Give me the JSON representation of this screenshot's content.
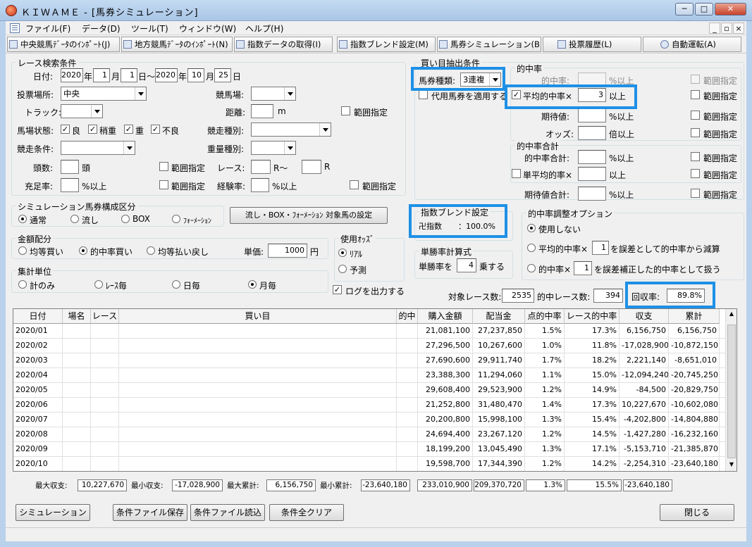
{
  "window": {
    "title": "ＫＩＷＡＭＥ - [馬券シミュレーション]",
    "min": "─",
    "max": "□",
    "close": "✕"
  },
  "menu": {
    "file": "ファイル(F)",
    "data": "データ(D)",
    "tool": "ツール(T)",
    "window": "ウィンドウ(W)",
    "help": "ヘルプ(H)",
    "mdi_min": "_",
    "mdi_restore": "▫",
    "mdi_close": "×"
  },
  "toolbar": {
    "b1": "中央競馬ﾃﾞｰﾀのｲﾝﾎﾟｰﾄ(J)",
    "b2": "地方競馬ﾃﾞｰﾀのｲﾝﾎﾟｰﾄ(N)",
    "b3": "指数データの取得(I)",
    "b4": "指数ブレンド設定(M)",
    "b5": "馬券シミュレーション(B)",
    "b6": "投票履歴(L)",
    "b7": "自動運転(A)"
  },
  "search": {
    "title": "レース検索条件",
    "date_lbl": "日付:",
    "y1": "2020",
    "m1": "1",
    "d1": "1",
    "y2": "2020",
    "m2": "10",
    "d2": "25",
    "nen": "年",
    "tsuki": "月",
    "nichi": "日",
    "kara": "日～",
    "venue_lbl": "投票場所:",
    "venue": "中央",
    "course_lbl": "競馬場:",
    "track_lbl": "トラック:",
    "dist_lbl": "距離:",
    "dist_unit": "m",
    "range": "範囲指定",
    "cond_lbl": "馬場状態:",
    "c1": "良",
    "c2": "稍重",
    "c3": "重",
    "c4": "不良",
    "type_lbl": "競走種別:",
    "jouken_lbl": "競走条件:",
    "weight_lbl": "重量種別:",
    "heads_lbl": "頭数:",
    "heads_unit": "頭",
    "race_lbl": "レース:",
    "race_r1": "R～",
    "race_r2": "R",
    "fill_lbl": "充足率:",
    "pct_up": "%以上",
    "exp_lbl": "経験率:"
  },
  "sim": {
    "title": "シミュレーション馬券構成区分",
    "o1": "通常",
    "o2": "流し",
    "o3": "BOX",
    "o4": "ﾌｫｰﾒｰｼｮﾝ",
    "setbtn": "流し・BOX・ﾌｫｰﾒｰｼｮﾝ 対象馬の設定"
  },
  "money": {
    "title": "金額配分",
    "o1": "均等買い",
    "o2": "的中率買い",
    "o3": "均等払い戻し",
    "unit_lbl": "単価:",
    "unit": "1000",
    "yen": "円"
  },
  "odds": {
    "title": "使用ｵｯｽﾞ",
    "o1": "ﾘｱﾙ",
    "o2": "予測"
  },
  "agg": {
    "title": "集計単位",
    "o1": "計のみ",
    "o2": "ﾚｰｽ毎",
    "o3": "日毎",
    "o4": "月毎"
  },
  "log": "ログを出力する",
  "buy": {
    "title": "買い目抽出条件",
    "kind_lbl": "馬券種類:",
    "kind": "3連複",
    "daiyou": "代用馬券を適用する"
  },
  "hit": {
    "title": "的中率",
    "r1": "的中率:",
    "r1u": "%以上",
    "r2": "平均的中率×",
    "r2v": "3",
    "r2u": "以上",
    "r3": "期待値:",
    "r3u": "%以上",
    "r4": "オッズ:",
    "r4u": "倍以上",
    "range": "範囲指定"
  },
  "hitsum": {
    "title": "的中率合計",
    "r1": "的中率合計:",
    "r1u": "%以上",
    "r2": "単平均的率×",
    "r2u": "以上",
    "r3": "期待値合計:",
    "r3u": "%以上"
  },
  "blend": {
    "title": "指数ブレンド設定",
    "name": "卍指数",
    "val": "：100.0%"
  },
  "tan": {
    "title": "単勝率計算式",
    "pre": "単勝率を",
    "val": "4",
    "post": "乗する"
  },
  "adj": {
    "title": "的中率調整オプション",
    "o1": "使用しない",
    "o2a": "平均的中率×",
    "o2v": "1",
    "o2b": "を誤差として的中率から減算",
    "o3a": "的中率×",
    "o3v": "1",
    "o3b": "を誤差補正した的中率として扱う"
  },
  "stats": {
    "target_lbl": "対象レース数:",
    "target": "2535",
    "hit_lbl": "的中レース数:",
    "hit": "394",
    "ret_lbl": "回収率:",
    "ret": "89.8%"
  },
  "grid": {
    "headers": [
      "日付",
      "場名",
      "レース",
      "買い目",
      "的中",
      "購入金額",
      "配当金",
      "点的中率",
      "レース的中率",
      "収支",
      "累計"
    ],
    "rows": [
      [
        "2020/01",
        "",
        "",
        "",
        "",
        "21,081,100",
        "27,237,850",
        "1.5%",
        "17.3%",
        "6,156,750",
        "6,156,750"
      ],
      [
        "2020/02",
        "",
        "",
        "",
        "",
        "27,296,500",
        "10,267,600",
        "1.0%",
        "11.8%",
        "-17,028,900",
        "-10,872,150"
      ],
      [
        "2020/03",
        "",
        "",
        "",
        "",
        "27,690,600",
        "29,911,740",
        "1.7%",
        "18.2%",
        "2,221,140",
        "-8,651,010"
      ],
      [
        "2020/04",
        "",
        "",
        "",
        "",
        "23,388,300",
        "11,294,060",
        "1.1%",
        "15.0%",
        "-12,094,240",
        "-20,745,250"
      ],
      [
        "2020/05",
        "",
        "",
        "",
        "",
        "29,608,400",
        "29,523,900",
        "1.2%",
        "14.9%",
        "-84,500",
        "-20,829,750"
      ],
      [
        "2020/06",
        "",
        "",
        "",
        "",
        "21,252,800",
        "31,480,470",
        "1.4%",
        "17.3%",
        "10,227,670",
        "-10,602,080"
      ],
      [
        "2020/07",
        "",
        "",
        "",
        "",
        "20,200,800",
        "15,998,100",
        "1.3%",
        "15.4%",
        "-4,202,800",
        "-14,804,880"
      ],
      [
        "2020/08",
        "",
        "",
        "",
        "",
        "24,694,400",
        "23,267,120",
        "1.2%",
        "14.5%",
        "-1,427,280",
        "-16,232,160"
      ],
      [
        "2020/09",
        "",
        "",
        "",
        "",
        "18,199,200",
        "13,045,490",
        "1.3%",
        "17.1%",
        "-5,153,710",
        "-21,385,870"
      ],
      [
        "2020/10",
        "",
        "",
        "",
        "",
        "19,598,700",
        "17,344,390",
        "1.2%",
        "14.2%",
        "-2,254,310",
        "-23,640,180"
      ]
    ]
  },
  "summary": {
    "maxinc_lbl": "最大収支:",
    "maxinc": "10,227,670",
    "mininc_lbl": "最小収支:",
    "mininc": "-17,028,900",
    "maxcum_lbl": "最大累計:",
    "maxcum": "6,156,750",
    "mincum_lbl": "最小累計:",
    "mincum": "-23,640,180",
    "buy": "233,010,900",
    "pay": "209,370,720",
    "pt": "1.3%",
    "race": "15.5%",
    "bal": "-23,640,180"
  },
  "buttons": {
    "sim": "シミュレーション",
    "save": "条件ファイル保存",
    "load": "条件ファイル読込",
    "clear": "条件全クリア",
    "close": "閉じる"
  }
}
